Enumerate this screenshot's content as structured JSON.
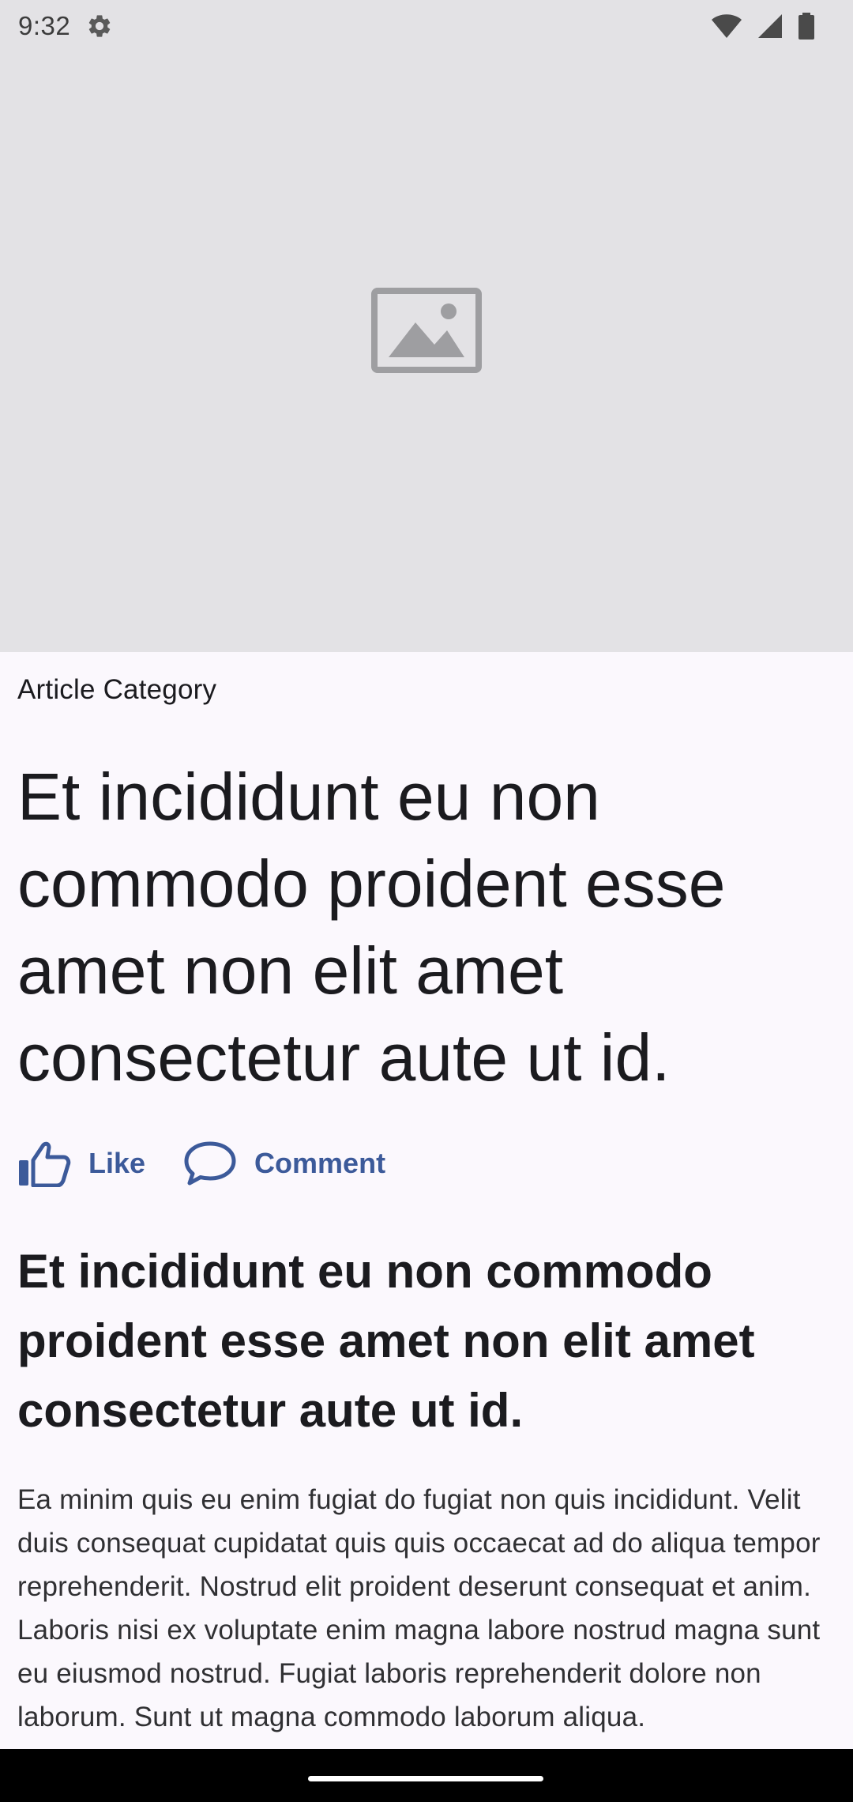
{
  "status_bar": {
    "time": "9:32",
    "icons": [
      "settings-icon",
      "wifi-icon",
      "cellular-signal-icon",
      "battery-icon"
    ]
  },
  "hero": {
    "icon": "image-placeholder-icon",
    "background_color": "#e3e2e5"
  },
  "article": {
    "category": "Article Category",
    "headline": "Et incididunt eu non commodo proident esse amet non elit amet consectetur aute ut id.",
    "actions": {
      "like_label": "Like",
      "like_icon": "thumbs-up-icon",
      "comment_label": "Comment",
      "comment_icon": "comment-icon",
      "accent_color": "#3c5a9a"
    },
    "subheadline": "Et incididunt eu non commodo proident esse amet non elit amet consectetur aute ut id.",
    "body": "Ea minim quis eu enim fugiat do fugiat non quis incididunt. Velit duis consequat cupidatat quis quis occaecat ad do aliqua tempor reprehenderit. Nostrud elit proident deserunt consequat et anim. Laboris nisi ex voluptate enim magna labore nostrud magna sunt eu eiusmod nostrud. Fugiat laboris reprehenderit dolore non laborum. Sunt ut magna commodo laborum aliqua."
  }
}
